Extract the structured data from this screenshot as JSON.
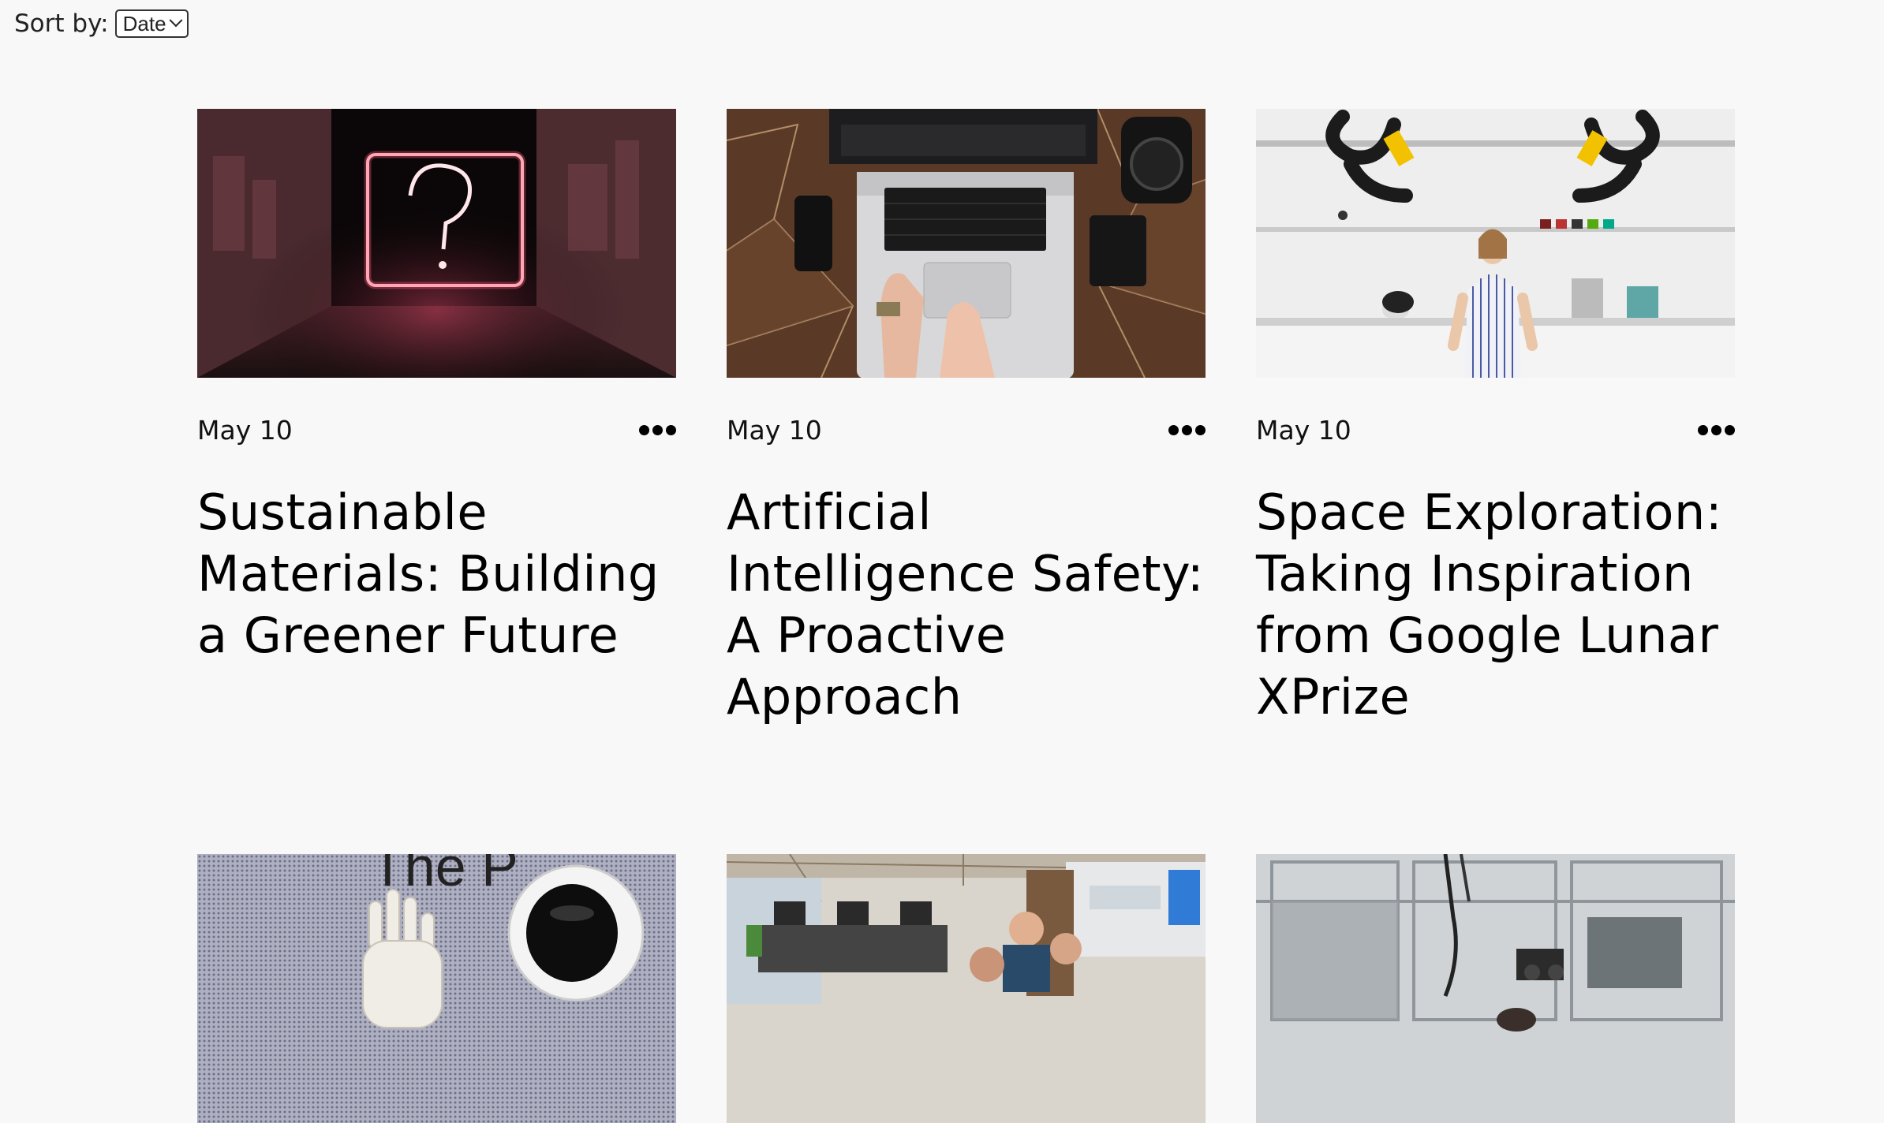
{
  "sort": {
    "label": "Sort by:",
    "selected": "Date"
  },
  "posts": [
    {
      "date": "May 10",
      "title": "Sustainable Materials: Building a Greener Future",
      "image": "neon-question-mark-tunnel"
    },
    {
      "date": "May 10",
      "title": "Artificial Intelligence Safety: A Proactive Approach",
      "image": "laptop-on-wooden-desk"
    },
    {
      "date": "May 10",
      "title": "Space Exploration: Taking Inspiration from Google Lunar XPrize",
      "image": "woman-in-robotics-lab"
    },
    {
      "date": "",
      "title": "",
      "image": "robot-and-hand-sign"
    },
    {
      "date": "",
      "title": "",
      "image": "open-office-meeting"
    },
    {
      "date": "",
      "title": "",
      "image": "industrial-machinery"
    }
  ]
}
